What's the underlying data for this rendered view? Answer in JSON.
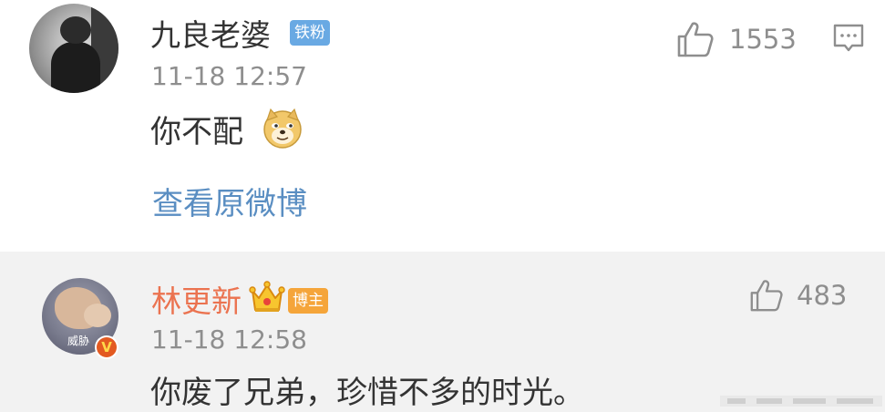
{
  "comments": [
    {
      "username": "九良老婆",
      "badge": "铁粉",
      "time": "11-18 12:57",
      "text": "你不配",
      "emoji": "doge-emoji",
      "link_label": "查看原微博",
      "like_count": "1553"
    },
    {
      "username": "林更新",
      "badge": "博主",
      "time": "11-18 12:58",
      "text": "你废了兄弟，珍惜不多的时光。",
      "like_count": "483",
      "avatar_watermark": "威胁",
      "verified_mark": "V"
    }
  ],
  "colors": {
    "name_default": "#333333",
    "name_author": "#eb7350",
    "link": "#5a8ec2",
    "badge_fan": "#69a9e3",
    "badge_author": "#f5a53a",
    "meta_gray": "#8e8e8e",
    "reply_background": "#f2f2f2"
  }
}
